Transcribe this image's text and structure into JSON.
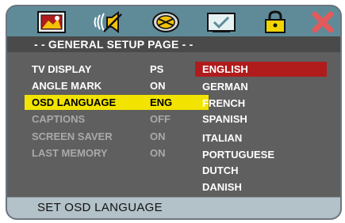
{
  "toolbar": {
    "icons": [
      {
        "name": "general-setup-icon",
        "active": true
      },
      {
        "name": "audio-setup-icon"
      },
      {
        "name": "video-setup-icon"
      },
      {
        "name": "preference-icon"
      },
      {
        "name": "password-lock-icon"
      },
      {
        "name": "exit-icon"
      }
    ]
  },
  "header": {
    "title": "- - GENERAL SETUP PAGE - -"
  },
  "settings": [
    {
      "label": "TV DISPLAY",
      "value": "PS",
      "state": "normal"
    },
    {
      "label": "ANGLE MARK",
      "value": "ON",
      "state": "normal"
    },
    {
      "label": "OSD LANGUAGE",
      "value": "ENG",
      "state": "selected"
    },
    {
      "label": "CAPTIONS",
      "value": "OFF",
      "state": "dim"
    },
    {
      "label": "SCREEN SAVER",
      "value": "ON",
      "state": "dim"
    },
    {
      "label": "LAST MEMORY",
      "value": "ON",
      "state": "dim"
    }
  ],
  "languages": [
    "ENGLISH",
    "GERMAN",
    "FRENCH",
    "SPANISH",
    "ITALIAN",
    "PORTUGUESE",
    "DUTCH",
    "DANISH"
  ],
  "selected_language": "ENGLISH",
  "footer": {
    "hint": "SET OSD LANGUAGE"
  },
  "colors": {
    "toolbar": "#5f8b99",
    "panel": "#5f5f5f",
    "highlight_yellow": "#f2e400",
    "highlight_red": "#b01c1c",
    "footer": "#b3c1c8"
  }
}
